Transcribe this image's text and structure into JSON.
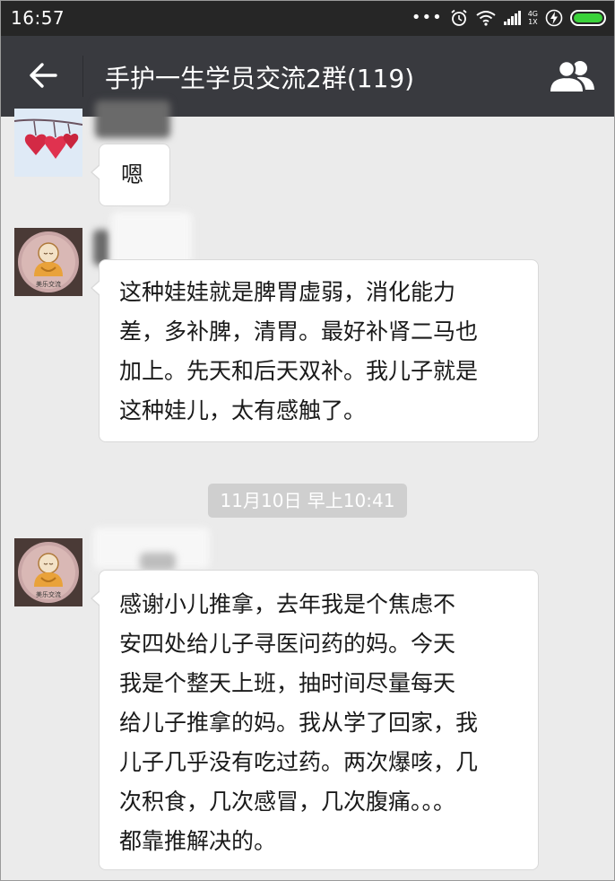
{
  "status_bar": {
    "time": "16:57",
    "network_type": "4G",
    "network_sub": "1X",
    "icons": [
      "more-dots-icon",
      "alarm-icon",
      "wifi-icon",
      "signal-icon",
      "charging-icon",
      "battery-icon"
    ],
    "battery_level": 1.0,
    "battery_color": "#3ad23a"
  },
  "nav": {
    "title": "手护一生学员交流2群(119)",
    "back_icon": "back-arrow-icon",
    "members_icon": "group-members-icon",
    "bar_color": "#393a3f"
  },
  "messages": [
    {
      "sender_avatar": "hearts-avatar",
      "text": "嗯"
    },
    {
      "sender_avatar": "monk-avatar",
      "text": "这种娃娃就是脾胃虚弱，消化能力\n差，多补脾，清胃。最好补肾二马也\n加上。先天和后天双补。我儿子就是\n这种娃儿，太有感触了。"
    },
    {
      "sender_avatar": "monk-avatar",
      "text": "感谢小儿推拿，去年我是个焦虑不\n安四处给儿子寻医问药的妈。今天\n我是个整天上班，抽时间尽量每天\n给儿子推拿的妈。我从学了回家，我\n儿子几乎没有吃过药。两次爆咳，几\n次积食，几次感冒，几次腹痛。。。\n都靠推解决的。"
    }
  ],
  "timestamp": "11月10日 早上10:41",
  "avatar_caption": "美乐交流",
  "colors": {
    "chat_bg": "#ebebeb",
    "bubble_bg": "#ffffff",
    "timestamp_bg": "#cfcfcf"
  }
}
